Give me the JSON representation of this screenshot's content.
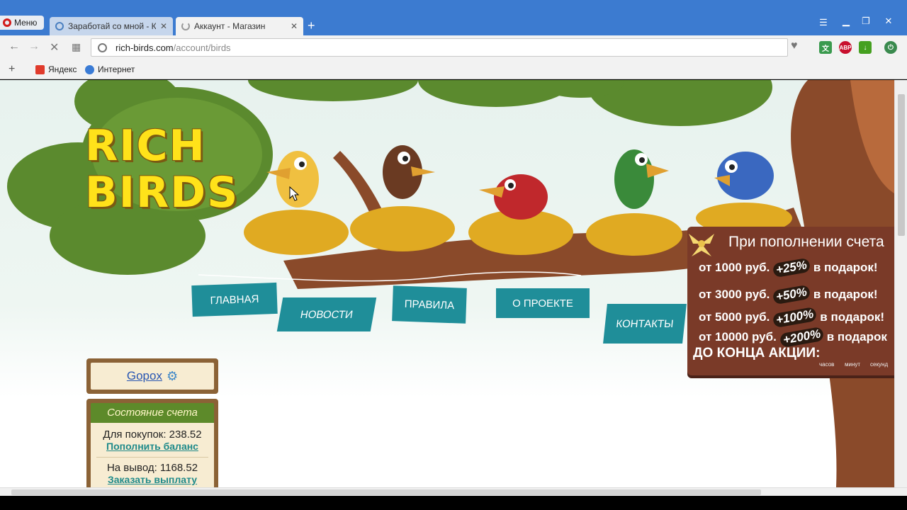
{
  "browser": {
    "menu_label": "Меню",
    "tabs": [
      {
        "title": "Заработай со мной - Кал",
        "active": false
      },
      {
        "title": "Аккаунт - Магазин",
        "active": true
      }
    ],
    "new_tab": "+",
    "url_host": "rich-birds.com",
    "url_path": "/account/birds",
    "bookmarks_add": "+",
    "bookmarks": [
      {
        "label": "Яндекс",
        "color": "#e03b2c"
      },
      {
        "label": "Интернет",
        "color": "#3a7bd5"
      }
    ],
    "extensions": [
      {
        "name": "translate-icon",
        "text": "文",
        "color": "#3a9a4e"
      },
      {
        "name": "adblock-icon",
        "text": "ABP",
        "color": "#c8102e"
      },
      {
        "name": "download-icon",
        "text": "↓",
        "color": "#45a020"
      },
      {
        "name": "power-icon",
        "text": "⏻",
        "color": "#3a8a4e"
      }
    ]
  },
  "site": {
    "logo_line1": "RICH",
    "logo_line2": "BIRDS",
    "nav": [
      "ГЛАВНАЯ",
      "НОВОСТИ",
      "ПРАВИЛА",
      "О ПРОЕКТЕ",
      "КОНТАКТЫ"
    ],
    "promo": {
      "title": "При пополнении счета",
      "rows": [
        {
          "from": "от 1000 руб.",
          "bonus": "+25%",
          "tail": "в подарок!"
        },
        {
          "from": "от 3000 руб.",
          "bonus": "+50%",
          "tail": "в подарок!"
        },
        {
          "from": "от 5000 руб.",
          "bonus": "+100%",
          "tail": "в подарок!"
        },
        {
          "from": "от 10000 руб.",
          "bonus": "+200%",
          "tail": "в подарок"
        }
      ],
      "until": "ДО КОНЦА АКЦИИ:",
      "units": [
        "часов",
        "минут",
        "секунд"
      ]
    },
    "user": {
      "name": "Gopox"
    },
    "account": {
      "title": "Состояние счета",
      "purchase_label": "Для покупок: 238.52",
      "topup_link": "Пополнить баланс",
      "withdraw_label": "На вывод: 1168.52",
      "withdraw_link": "Заказать выплату"
    }
  },
  "colors": {
    "tabbar": "#3c7bd0",
    "nav_tab": "#1f8e99",
    "promo_bg": "#7a3a28",
    "tree_green": "#5b8a2e"
  }
}
